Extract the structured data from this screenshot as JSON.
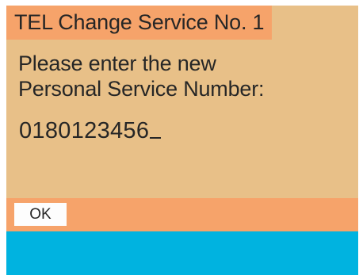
{
  "header": {
    "title": "TEL Change Service No. 1"
  },
  "prompt": {
    "line1": "Please enter the new",
    "line2": "Personal Service Number:"
  },
  "entry": {
    "value": "0180123456"
  },
  "softkeys": {
    "ok_label": "OK"
  },
  "colors": {
    "background": "#e8c088",
    "accent_bar": "#f6a36a",
    "bottom_band": "#00b3e0",
    "text": "#262626"
  }
}
